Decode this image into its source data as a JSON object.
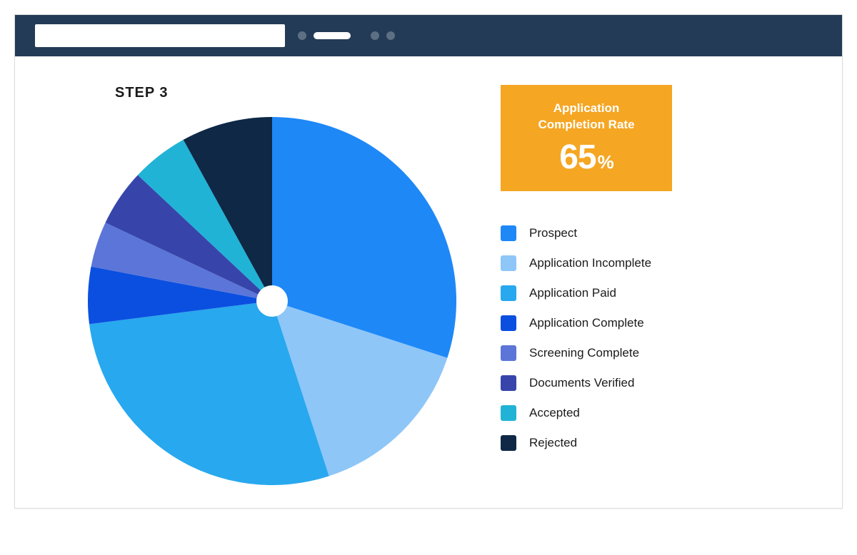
{
  "step_label": "STEP 3",
  "metric": {
    "title_line1": "Application",
    "title_line2": "Completion Rate",
    "value": "65",
    "suffix": "%"
  },
  "chart_data": {
    "type": "pie",
    "title": "",
    "series": [
      {
        "name": "Prospect",
        "value": 30,
        "color": "#1E88F7"
      },
      {
        "name": "Application Incomplete",
        "value": 15,
        "color": "#8EC6F8"
      },
      {
        "name": "Application Paid",
        "value": 28,
        "color": "#28A8EE"
      },
      {
        "name": "Application Complete",
        "value": 5,
        "color": "#0B4FE0"
      },
      {
        "name": "Screening Complete",
        "value": 4,
        "color": "#5B76D8"
      },
      {
        "name": "Documents Verified",
        "value": 5,
        "color": "#3745AB"
      },
      {
        "name": "Accepted",
        "value": 5,
        "color": "#21B3D6"
      },
      {
        "name": "Rejected",
        "value": 8,
        "color": "#0E2846"
      }
    ]
  }
}
